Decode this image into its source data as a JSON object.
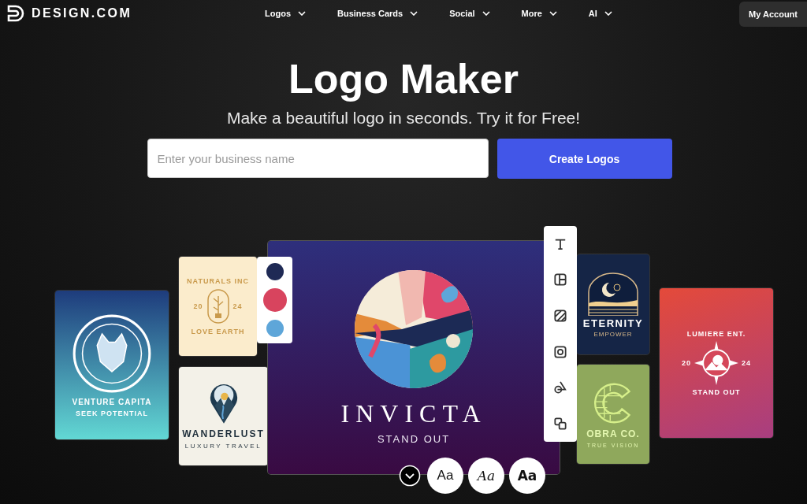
{
  "brand": {
    "name": "DESIGN.COM"
  },
  "nav": [
    {
      "label": "Logos"
    },
    {
      "label": "Business Cards"
    },
    {
      "label": "Social"
    },
    {
      "label": "More"
    },
    {
      "label": "AI"
    }
  ],
  "account_button": "My Account",
  "hero": {
    "title": "Logo Maker",
    "subtitle": "Make a beautiful logo in seconds. Try it for Free!",
    "search": {
      "placeholder": "Enter your business name"
    },
    "cta": "Create Logos"
  },
  "showcase": {
    "cards": [
      {
        "kind": "venture",
        "lines": [
          "VENTURE CAPITA",
          "SEEK POTENTIAL"
        ]
      },
      {
        "kind": "naturals",
        "lines": [
          "NATURALS INC",
          "20",
          "24",
          "LOVE EARTH"
        ]
      },
      {
        "kind": "wanderlust",
        "lines": [
          "WANDERLUST",
          "LUXURY TRAVEL"
        ]
      },
      {
        "kind": "invicta",
        "lines": [
          "INVICTA",
          "STAND OUT"
        ]
      },
      {
        "kind": "eternity",
        "lines": [
          "ETERNITY",
          "EMPOWER"
        ]
      },
      {
        "kind": "cobra",
        "lines": [
          "OBRA CO.",
          "TRUE VISION"
        ]
      },
      {
        "kind": "lumiere",
        "lines": [
          "LUMIERE ENT.",
          "20",
          "24",
          "STAND OUT"
        ]
      }
    ],
    "palette": [
      {
        "color": "#1f2a55",
        "selected": false
      },
      {
        "color": "#d8445e",
        "selected": true
      },
      {
        "color": "#5ea6d9",
        "selected": false
      }
    ],
    "tools": [
      {
        "kind": "text"
      },
      {
        "kind": "layout"
      },
      {
        "kind": "pattern"
      },
      {
        "kind": "frame"
      },
      {
        "kind": "shapes"
      },
      {
        "kind": "layers"
      }
    ],
    "font_styles": [
      {
        "label": "Aa",
        "kind": "regular"
      },
      {
        "label": "Aa",
        "kind": "script"
      },
      {
        "label": "Aa",
        "kind": "bold"
      }
    ]
  }
}
